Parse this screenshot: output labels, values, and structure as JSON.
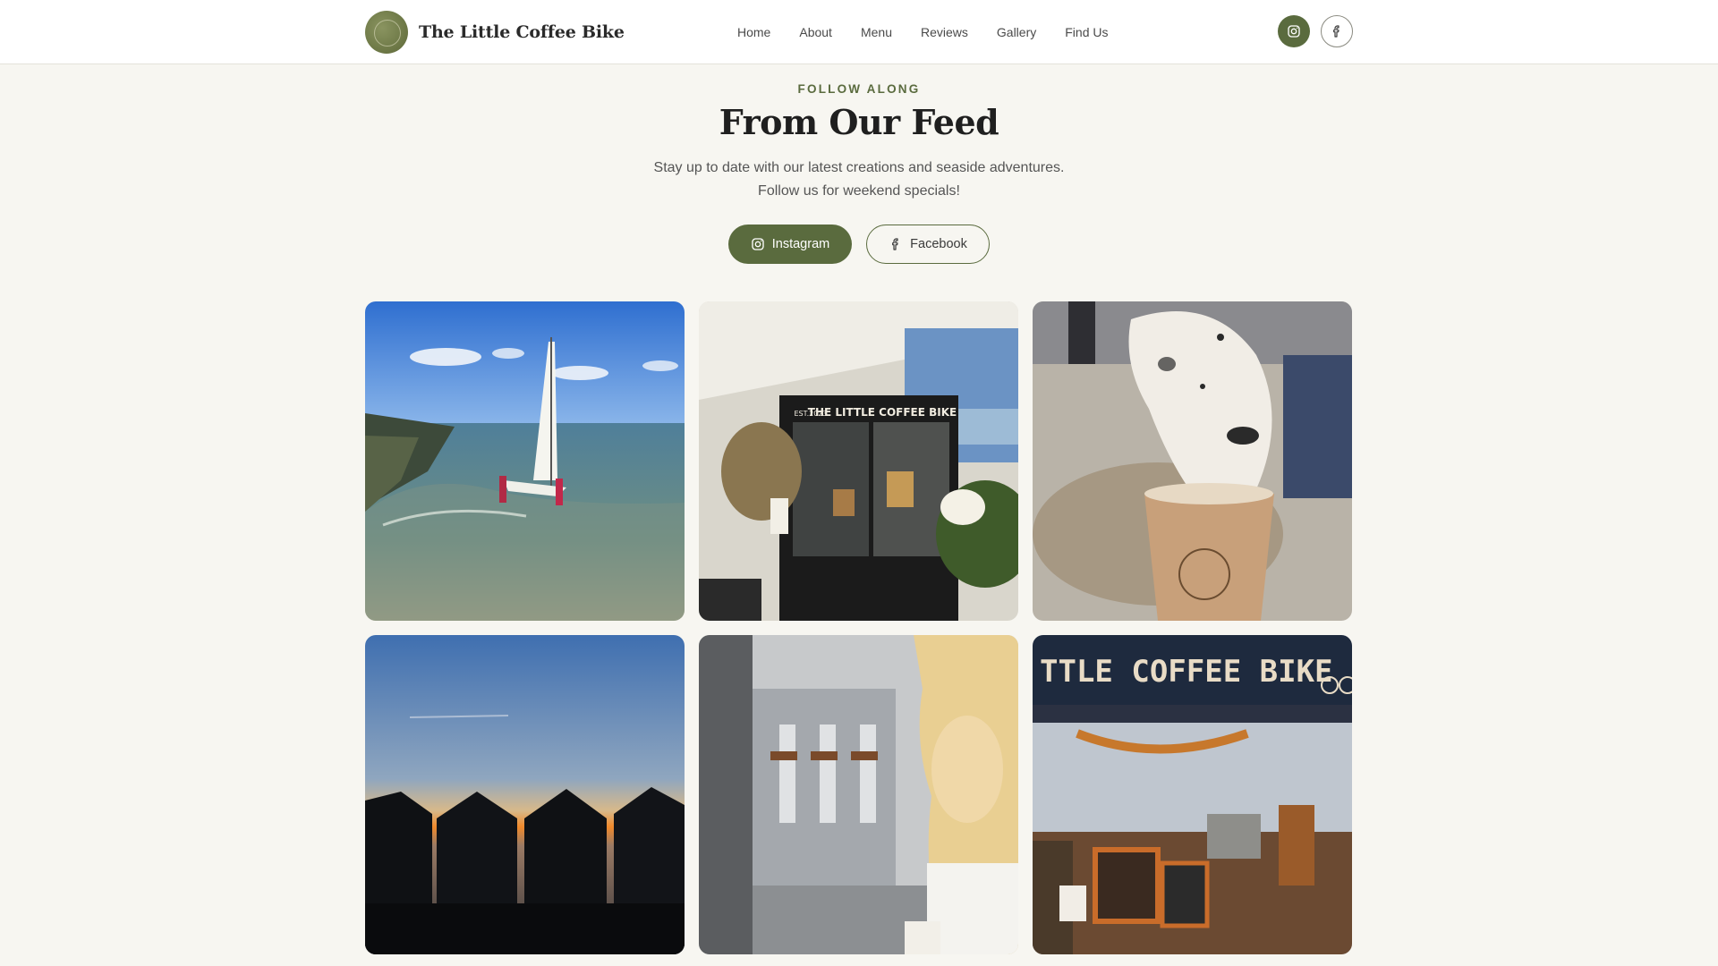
{
  "header": {
    "brand_name": "The Little Coffee Bike",
    "nav": [
      "Home",
      "About",
      "Menu",
      "Reviews",
      "Gallery",
      "Find Us"
    ],
    "social_icons": [
      "instagram-icon",
      "facebook-icon"
    ]
  },
  "feed": {
    "eyebrow": "FOLLOW ALONG",
    "title": "From Our Feed",
    "subtitle_line1": "Stay up to date with our latest creations and seaside adventures.",
    "subtitle_line2": "Follow us for weekend specials!",
    "buttons": {
      "instagram": "Instagram",
      "facebook": "Facebook"
    }
  },
  "gallery": {
    "items": [
      {
        "subject": "sailboat-launch-at-shoreline"
      },
      {
        "subject": "coffee-bike-stall-under-canopy"
      },
      {
        "subject": "dog-sniffing-coffee-cup"
      },
      {
        "subject": "beach-huts-at-sunset"
      },
      {
        "subject": "barista-at-espresso-machine"
      },
      {
        "subject": "little-coffee-bike-sign-and-stall"
      }
    ],
    "sign_text": "TTLE COFFEE BIKE",
    "stall_sign": "THE LITTLE COFFEE BIKE",
    "est_text": "EST.2023"
  },
  "colors": {
    "accent": "#5a6b3e",
    "background": "#f7f6f1",
    "header_bg": "#ffffff"
  }
}
